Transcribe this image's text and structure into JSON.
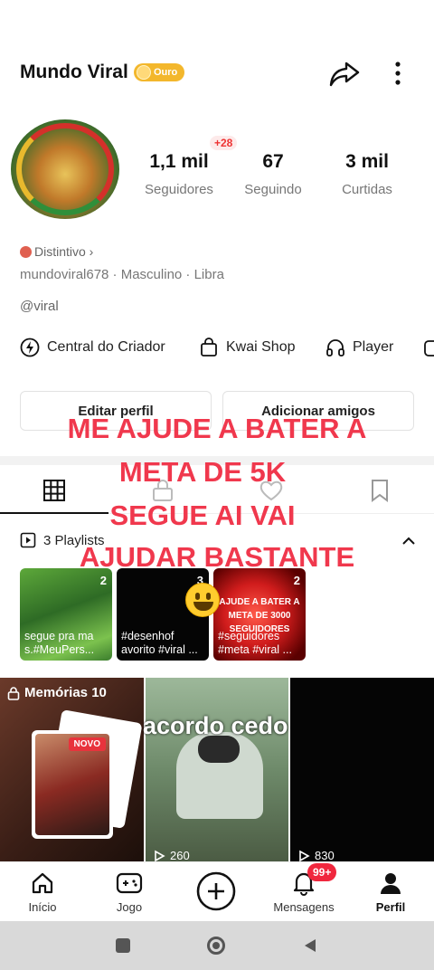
{
  "header": {
    "title": "Mundo Viral",
    "badge": "Ouro"
  },
  "stats": [
    {
      "value": "1,1 mil",
      "label": "Seguidores"
    },
    {
      "value": "67",
      "label": "Seguindo"
    },
    {
      "value": "3 mil",
      "label": "Curtidas"
    }
  ],
  "new_followers": "+28",
  "profile": {
    "distintivo": "Distintivo ›",
    "meta": "mundoviral678  ·  Masculino  ·  Libra",
    "handle": "@viral"
  },
  "shortcuts": [
    {
      "label": "Central do Criador",
      "icon": "creator-bolt-icon"
    },
    {
      "label": "Kwai Shop",
      "icon": "shopping-bag-icon"
    },
    {
      "label": "Player",
      "icon": "headphones-icon"
    }
  ],
  "buttons": {
    "edit": "Editar perfil",
    "add": "Adicionar amigos"
  },
  "playlists_label": "3 Playlists",
  "playlists": [
    {
      "count": "2",
      "text": "segue pra ma s.#MeuPers..."
    },
    {
      "count": "3",
      "text": "#desenhof avorito #viral ..."
    },
    {
      "count": "2",
      "text": "#seguidores #meta #viral ...",
      "cover": "AJUDE A BATER A META DE 3000 SEGUIDORES"
    }
  ],
  "videos": [
    {
      "label": "Memórias 10",
      "tag": "NOVO"
    },
    {
      "caption": "acordo cedo",
      "views": "260"
    },
    {
      "views": "830"
    }
  ],
  "overlay_lines": [
    "ME AJUDE A BATER A",
    "META DE 5K",
    "SEGUE AI VAI",
    "AJUDAR BASTANTE"
  ],
  "nav": [
    {
      "label": "Início"
    },
    {
      "label": "Jogo"
    },
    {
      "label": ""
    },
    {
      "label": "Mensagens"
    },
    {
      "label": "Perfil"
    }
  ],
  "messages_badge": "99+",
  "colors": {
    "accent": "#f0384d",
    "gold": "#f3b72c"
  }
}
